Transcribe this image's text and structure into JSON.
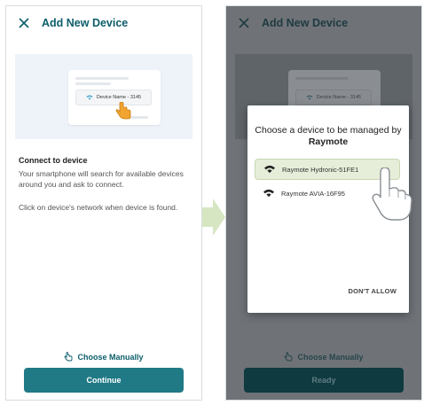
{
  "left_screen": {
    "header": {
      "title": "Add New Device",
      "close_icon": "close-icon"
    },
    "illustration": {
      "device_label": "Device Name - 3145",
      "icons": [
        "wifi-icon",
        "hand-pointer-icon"
      ]
    },
    "section_title": "Connect to device",
    "body_text_1": "Your smartphone will search for available devices around you and ask to connect.",
    "body_text_2": "Click on device's network when device is found.",
    "choose_manually": "Choose Manually",
    "primary_button": "Continue",
    "accent_color": "#1f7a86"
  },
  "right_screen": {
    "header": {
      "title": "Add New Device"
    },
    "illustration": {
      "device_label": "Device Name - 3145"
    },
    "dialog": {
      "title_prefix": "Choose a device to be managed by",
      "title_brand": "Raymote",
      "devices": [
        {
          "name": "Raymote Hydronic-51FE1",
          "icon": "wifi-icon",
          "selected": true
        },
        {
          "name": "Raymote AVIA-16F95",
          "icon": "wifi-icon",
          "selected": false
        }
      ],
      "dont_allow": "DON'T ALLOW"
    },
    "choose_manually": "Choose Manually",
    "primary_button": "Ready"
  }
}
